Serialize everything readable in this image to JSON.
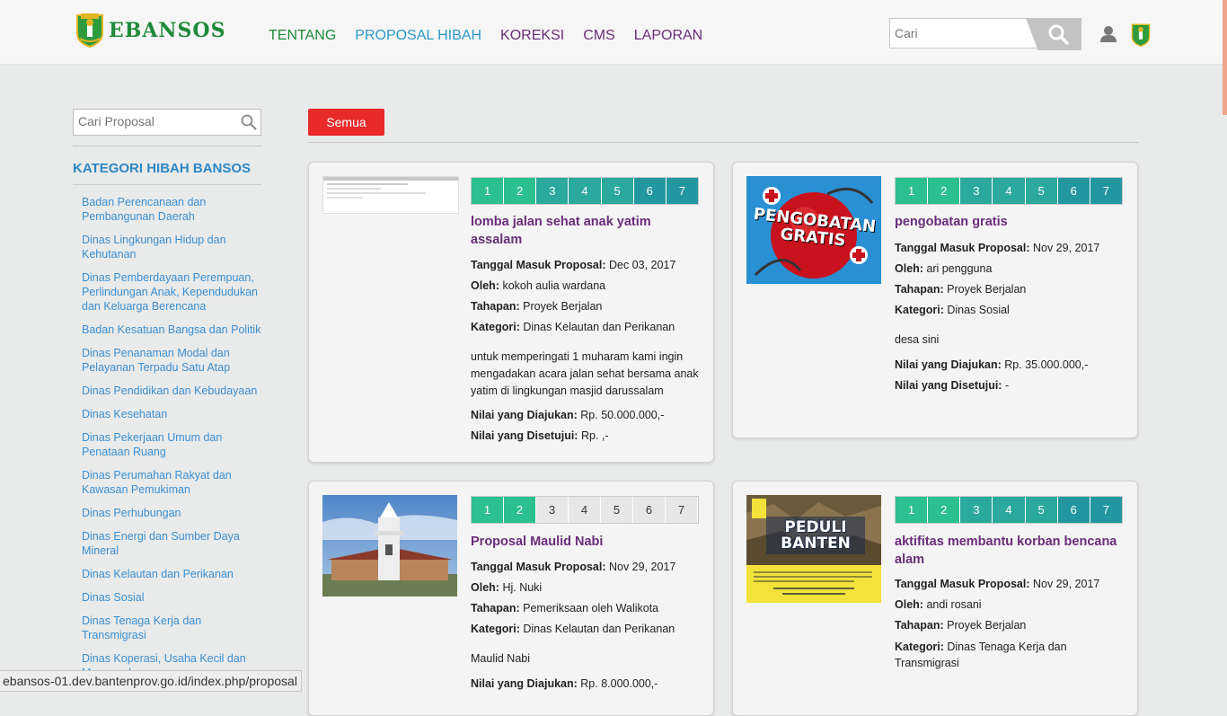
{
  "header": {
    "brand": "EBANSOS",
    "nav": [
      {
        "label": "TENTANG",
        "color": "#1e8a3a"
      },
      {
        "label": "PROPOSAL HIBAH",
        "color": "#2c98c8"
      },
      {
        "label": "KOREKSI",
        "color": "#6a2d78"
      },
      {
        "label": "CMS",
        "color": "#6a2d78"
      },
      {
        "label": "LAPORAN",
        "color": "#6a2d78"
      }
    ],
    "search_placeholder": "Cari"
  },
  "sidebar": {
    "search_placeholder": "Cari Proposal",
    "title": "KATEGORI HIBAH BANSOS",
    "items": [
      "Badan Perencanaan dan Pembangunan Daerah",
      "Dinas Lingkungan Hidup dan Kehutanan",
      "Dinas Pemberdayaan Perempuan, Perlindungan Anak, Kependudukan dan Keluarga Berencana",
      "Badan Kesatuan Bangsa dan Politik",
      "Dinas Penanaman Modal dan Pelayanan Terpadu Satu Atap",
      "Dinas Pendidikan dan Kebudayaan",
      "Dinas Kesehatan",
      "Dinas Pekerjaan Umum dan Penataan Ruang",
      "Dinas Perumahan Rakyat dan Kawasan Pemukiman",
      "Dinas Perhubungan",
      "Dinas Energi dan Sumber Daya Mineral",
      "Dinas Kelautan dan Perikanan",
      "Dinas Sosial",
      "Dinas Tenaga Kerja dan Transmigrasi",
      "Dinas Koperasi, Usaha Kecil dan Menengah"
    ]
  },
  "filter": {
    "label": "Semua"
  },
  "labels": {
    "tanggal": "Tanggal Masuk Proposal:",
    "oleh": "Oleh:",
    "tahapan": "Tahapan:",
    "kategori": "Kategori:",
    "nilai_diajukan": "Nilai yang Diajukan:",
    "nilai_disetujui": "Nilai yang Disetujui:"
  },
  "cards": [
    {
      "title": "lomba jalan sehat anak yatim assalam",
      "steps": [
        "1",
        "2",
        "3",
        "4",
        "5",
        "6",
        "7"
      ],
      "completed_steps": 7,
      "tanggal": "Dec 03, 2017",
      "oleh": "kokoh aulia wardana",
      "tahapan": "Proyek Berjalan",
      "kategori": "Dinas Kelautan dan Perikanan",
      "description": "untuk memperingati 1 muharam kami ingin mengadakan acara jalan sehat bersama anak yatim di lingkungan masjid darussalam",
      "nilai_diajukan": "Rp. 50.000.000,-",
      "nilai_disetujui": "Rp. ,-"
    },
    {
      "title": "pengobatan gratis",
      "image_text": "PENGOBATAN GRATIS",
      "steps": [
        "1",
        "2",
        "3",
        "4",
        "5",
        "6",
        "7"
      ],
      "completed_steps": 7,
      "tanggal": "Nov 29, 2017",
      "oleh": "ari pengguna",
      "tahapan": "Proyek Berjalan",
      "kategori": "Dinas Sosial",
      "description": "desa sini",
      "nilai_diajukan": "Rp. 35.000.000,-",
      "nilai_disetujui": "-"
    },
    {
      "title": "Proposal Maulid Nabi",
      "steps": [
        "1",
        "2",
        "3",
        "4",
        "5",
        "6",
        "7"
      ],
      "completed_steps": 2,
      "tanggal": "Nov 29, 2017",
      "oleh": "Hj. Nuki",
      "tahapan": "Pemeriksaan oleh Walikota",
      "kategori": "Dinas Kelautan dan Perikanan",
      "description": "Maulid Nabi",
      "nilai_diajukan": "Rp. 8.000.000,-"
    },
    {
      "title": "aktifitas membantu korban bencana alam",
      "image_text": "PEDULI BANTEN",
      "steps": [
        "1",
        "2",
        "3",
        "4",
        "5",
        "6",
        "7"
      ],
      "completed_steps": 7,
      "tanggal": "Nov 29, 2017",
      "oleh": "andi rosani",
      "tahapan": "Proyek Berjalan",
      "kategori": "Dinas Tenaga Kerja dan Transmigrasi"
    }
  ],
  "statusbar": {
    "url": "ebansos-01.dev.bantenprov.go.id/index.php/proposal"
  }
}
